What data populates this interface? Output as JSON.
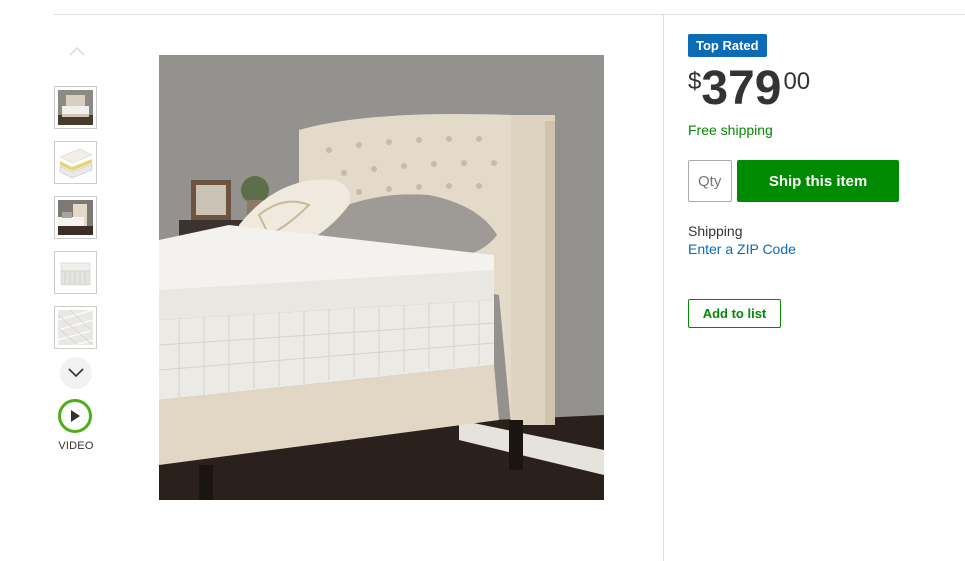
{
  "gallery": {
    "thumbnails": [
      {
        "alt": "bed-frame-room-thumbnail"
      },
      {
        "alt": "mattress-layers-thumbnail"
      },
      {
        "alt": "headboard-closeup-thumbnail"
      },
      {
        "alt": "mattress-corner-thumbnail"
      },
      {
        "alt": "mattress-quilting-thumbnail"
      }
    ],
    "video_label": "VIDEO"
  },
  "product": {
    "badge": "Top Rated",
    "price": {
      "currency": "$",
      "dollars": "379",
      "cents": "00"
    },
    "shipping_note": "Free shipping",
    "qty_placeholder": "Qty",
    "ship_button": "Ship this item",
    "shipping_label": "Shipping",
    "zip_link": "Enter a ZIP Code",
    "add_to_list": "Add to list"
  },
  "colors": {
    "accent_green": "#008a00",
    "badge_blue": "#0b6bb5",
    "link_blue": "#0b6bb5",
    "video_ring": "#4caf1a"
  },
  "icons": {
    "up": "chevron-up-icon",
    "down": "chevron-down-icon",
    "video": "play-icon"
  }
}
